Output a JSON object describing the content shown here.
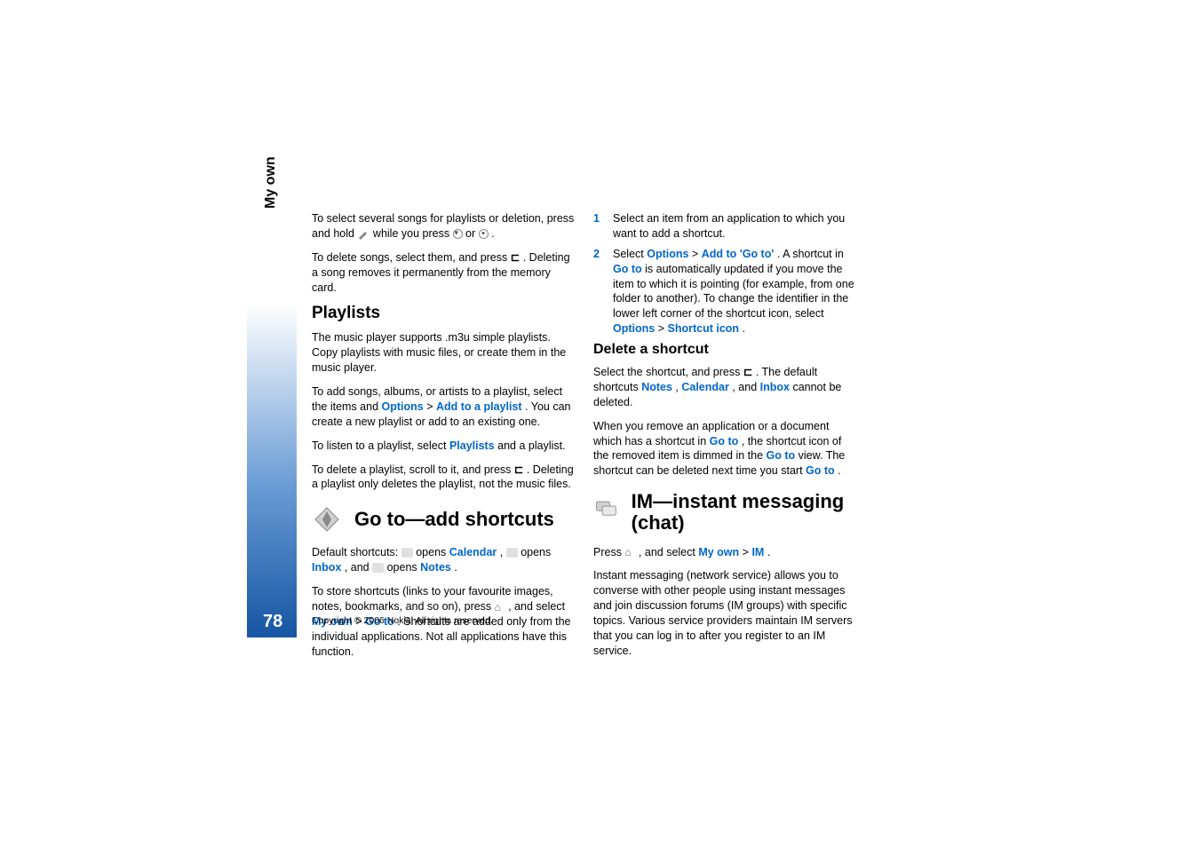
{
  "sideLabel": "My own",
  "pageNumber": "78",
  "copyright": "Copyright © 2006 Nokia. All rights reserved.",
  "col1": {
    "p1_a": "To select several songs for playlists or deletion, press and hold ",
    "p1_b": " while you press ",
    "p1_c": " or ",
    "p1_d": ".",
    "p2_a": "To delete songs, select them, and press ",
    "p2_b": " . Deleting a song removes it permanently from the memory card.",
    "h_playlists": "Playlists",
    "p3": "The music player supports .m3u simple playlists. Copy playlists with music files, or create them in the music player.",
    "p4_a": "To add songs, albums, or artists to a playlist, select the items and ",
    "p4_options": "Options",
    "p4_gt": " > ",
    "p4_addto": "Add to a playlist",
    "p4_b": ". You can create a new playlist or add to an existing one.",
    "p5_a": "To listen to a playlist, select ",
    "p5_playlists": "Playlists",
    "p5_b": " and a playlist.",
    "p6_a": "To delete a playlist, scroll to it, and press ",
    "p6_b": " . Deleting a playlist only deletes the playlist, not the music files.",
    "h_goto": "Go to—add shortcuts",
    "p7_a": "Default shortcuts: ",
    "p7_b": " opens ",
    "p7_cal": "Calendar",
    "p7_c": ", ",
    "p7_d": " opens ",
    "p7_inbox": "Inbox",
    "p7_e": ", and ",
    "p7_f": " opens ",
    "p7_notes": "Notes",
    "p7_g": ".",
    "p8_a": "To store shortcuts (links to your favourite images, notes, bookmarks, and so on), press ",
    "p8_b": " , and select ",
    "p8_myown": "My own",
    "p8_gt": " > ",
    "p8_goto": "Go to",
    "p8_c": ". Shortcuts are added only from the individual applications. Not all applications have this function."
  },
  "col2": {
    "li1_num": "1",
    "li1": "Select an item from an application to which you want to add a shortcut.",
    "li2_num": "2",
    "li2_a": "Select ",
    "li2_options": "Options",
    "li2_gt1": " > ",
    "li2_addgoto": "Add to 'Go to'",
    "li2_b": ". A shortcut in ",
    "li2_goto1": "Go to",
    "li2_c": " is automatically updated if you move the item to which it is pointing (for example, from one folder to another). To change the identifier in the lower left corner of the shortcut icon, select ",
    "li2_options2": "Options",
    "li2_gt2": " > ",
    "li2_shortcuticon": "Shortcut icon",
    "li2_d": ".",
    "h_delete": "Delete a shortcut",
    "p9_a": "Select the shortcut, and press ",
    "p9_b": ". The default shortcuts ",
    "p9_notes": "Notes",
    "p9_c": ", ",
    "p9_cal": "Calendar",
    "p9_d": ", and ",
    "p9_inbox": "Inbox",
    "p9_e": " cannot be deleted.",
    "p10_a": "When you remove an application or a document which has a shortcut in ",
    "p10_goto1": "Go to",
    "p10_b": ", the shortcut icon of the removed item is dimmed in the ",
    "p10_goto2": "Go to",
    "p10_c": " view. The shortcut can be deleted next time you start ",
    "p10_goto3": "Go to",
    "p10_d": ".",
    "h_im": "IM—instant messaging (chat)",
    "p11_a": "Press ",
    "p11_b": " , and select ",
    "p11_myown": "My own",
    "p11_gt": " > ",
    "p11_im": "IM",
    "p11_c": ".",
    "p12": "Instant messaging (network service) allows you to converse with other people using instant messages and join discussion forums (IM groups) with specific topics. Various service providers maintain IM servers that you can log in to after you register to an IM service."
  }
}
